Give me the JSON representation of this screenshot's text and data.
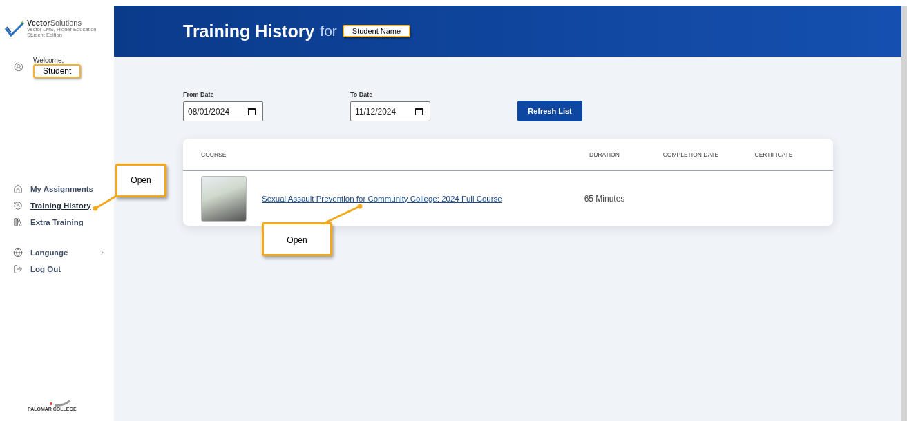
{
  "sidebar": {
    "logo": {
      "brand": "**Vector**Solutions",
      "subtitle": "Vector LMS, Higher Education Student Edition"
    },
    "welcome": "Welcome,",
    "user_name": "Student",
    "nav": [
      {
        "kind": "home",
        "label": "My Assignments",
        "selected": false
      },
      {
        "kind": "history",
        "label": "Training History",
        "selected": true
      },
      {
        "kind": "books",
        "label": "Extra Training",
        "selected": false
      }
    ],
    "menu": [
      {
        "kind": "globe",
        "label": "Language",
        "submenu": true
      },
      {
        "kind": "logout",
        "label": "Log Out",
        "submenu": false
      }
    ],
    "footer_logo": "PALOMAR COLLEGE"
  },
  "header": {
    "title": "Training History",
    "connector": "for",
    "student_name": "Student Name"
  },
  "filters": [
    {
      "label": "From Date",
      "value": "08/01/2024"
    },
    {
      "label": "To Date",
      "value": "11/12/2024"
    }
  ],
  "refresh_button": "Refresh List",
  "table": {
    "columns": [
      "COURSE",
      "DURATION",
      "COMPLETION DATE",
      "CERTIFICATE"
    ],
    "rows": [
      {
        "course": "Sexual Assault Prevention for Community College: 2024 Full Course",
        "duration": "65 Minutes"
      }
    ]
  },
  "callouts": [
    {
      "text": "Open"
    },
    {
      "text": "Open"
    }
  ]
}
